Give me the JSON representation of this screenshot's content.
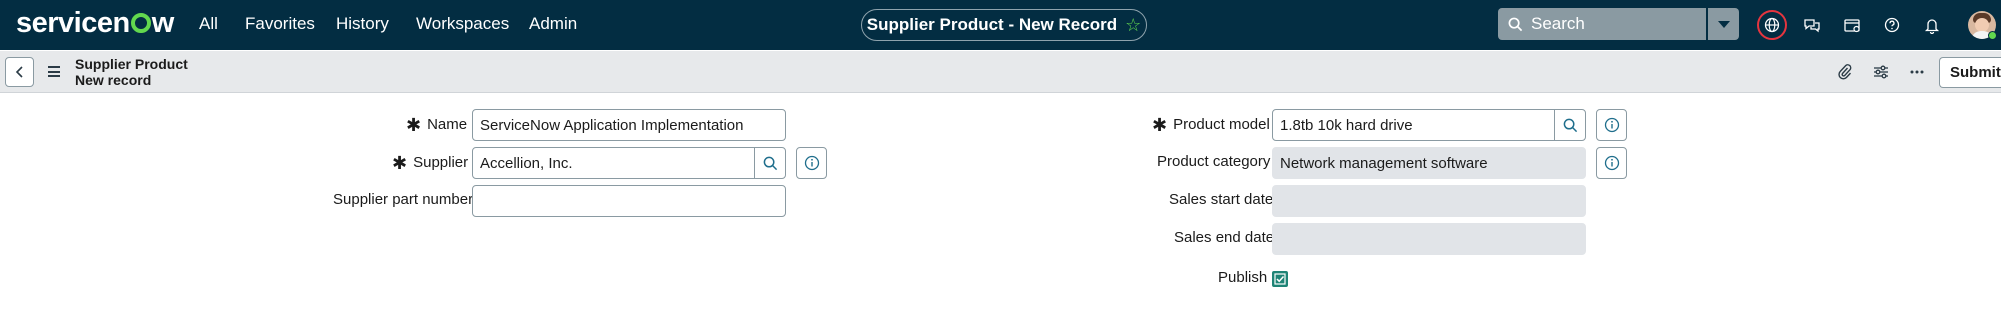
{
  "app": {
    "logo_text_left": "servicen",
    "logo_text_right": "w"
  },
  "topnav": {
    "items": [
      "All",
      "Favorites",
      "History",
      "Workspaces",
      "Admin"
    ],
    "record_title": "Supplier Product - New Record",
    "search_placeholder": "Search"
  },
  "subheader": {
    "title_line1": "Supplier Product",
    "title_line2": "New record",
    "submit_label": "Submit"
  },
  "form": {
    "left": [
      {
        "label": "Name",
        "required": true,
        "value": "ServiceNow Application Implementation"
      },
      {
        "label": "Supplier",
        "required": true,
        "value": "Accellion, Inc."
      },
      {
        "label": "Supplier part number",
        "required": false,
        "value": ""
      }
    ],
    "right": [
      {
        "label": "Product model",
        "required": true,
        "value": "1.8tb 10k hard drive"
      },
      {
        "label": "Product category",
        "required": false,
        "value": "Network management software"
      },
      {
        "label": "Sales start date",
        "required": false,
        "value": ""
      },
      {
        "label": "Sales end date",
        "required": false,
        "value": ""
      },
      {
        "label": "Publish",
        "required": false,
        "checked": true
      }
    ],
    "required_marker": "✱"
  },
  "colors": {
    "nav_bg": "#032d42",
    "accent_green": "#62d84e",
    "focus_ring": "#e5353f",
    "lookup_icon": "#1f6e8c",
    "readonly_bg": "#e1e4e8",
    "checkbox": "#1f8476"
  },
  "icons": {
    "favorite": "star-outline-icon",
    "search": "search-icon",
    "globe": "globe-icon",
    "chat": "chat-icon",
    "card": "card-icon",
    "help": "help-icon",
    "notifications": "bell-icon",
    "attachment": "paperclip-icon",
    "settings": "sliders-icon",
    "more": "ellipsis-icon",
    "lookup": "search-icon",
    "info": "info-icon"
  }
}
